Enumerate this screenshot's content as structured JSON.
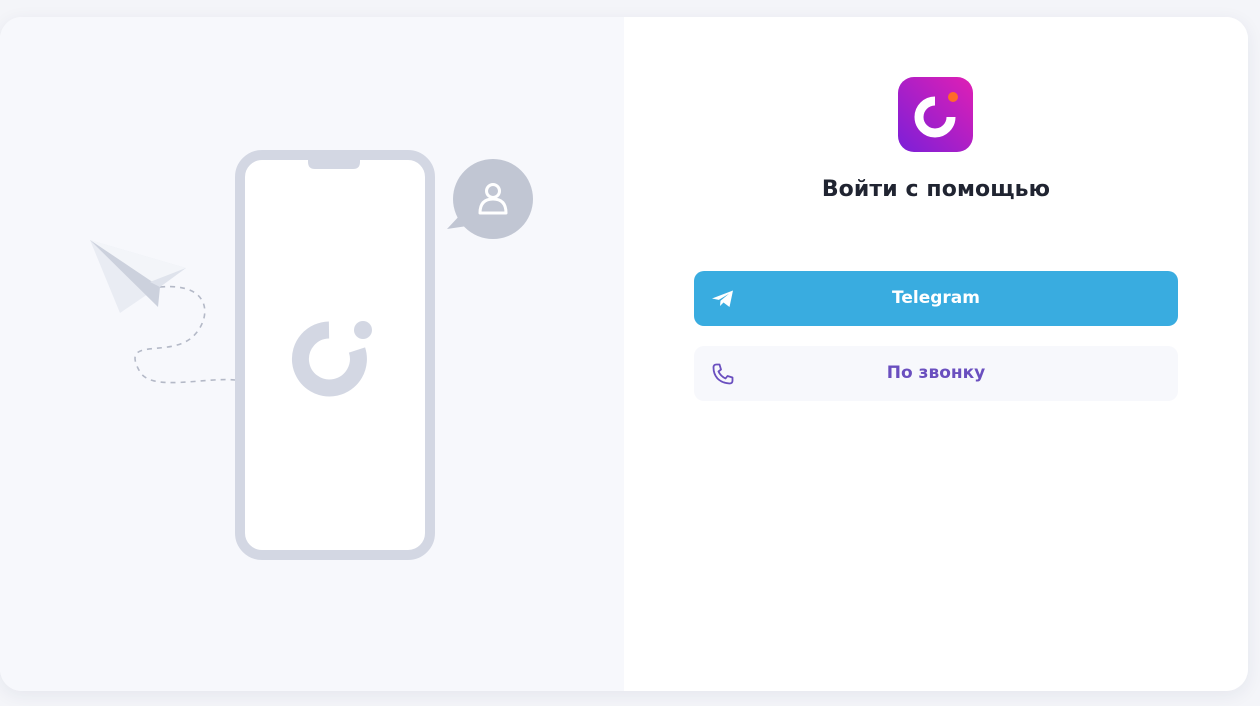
{
  "login": {
    "title": "Войти с помощью",
    "telegram_button_label": "Telegram",
    "call_button_label": "По звонку"
  },
  "icons": {
    "logo": "app-logo-icon",
    "telegram": "telegram-paper-plane-icon",
    "call": "phone-icon",
    "illustration_user": "user-icon",
    "illustration_plane": "paper-plane-icon"
  },
  "colors": {
    "telegram_button": "#39ace0",
    "call_button_bg": "#f7f8fc",
    "call_button_text": "#6a4fbf",
    "logo_gradient_start": "#7b1fd8",
    "logo_gradient_end": "#e01fb4",
    "logo_dot": "#ff6a2b",
    "illustration_gray": "#d3d7e3"
  }
}
